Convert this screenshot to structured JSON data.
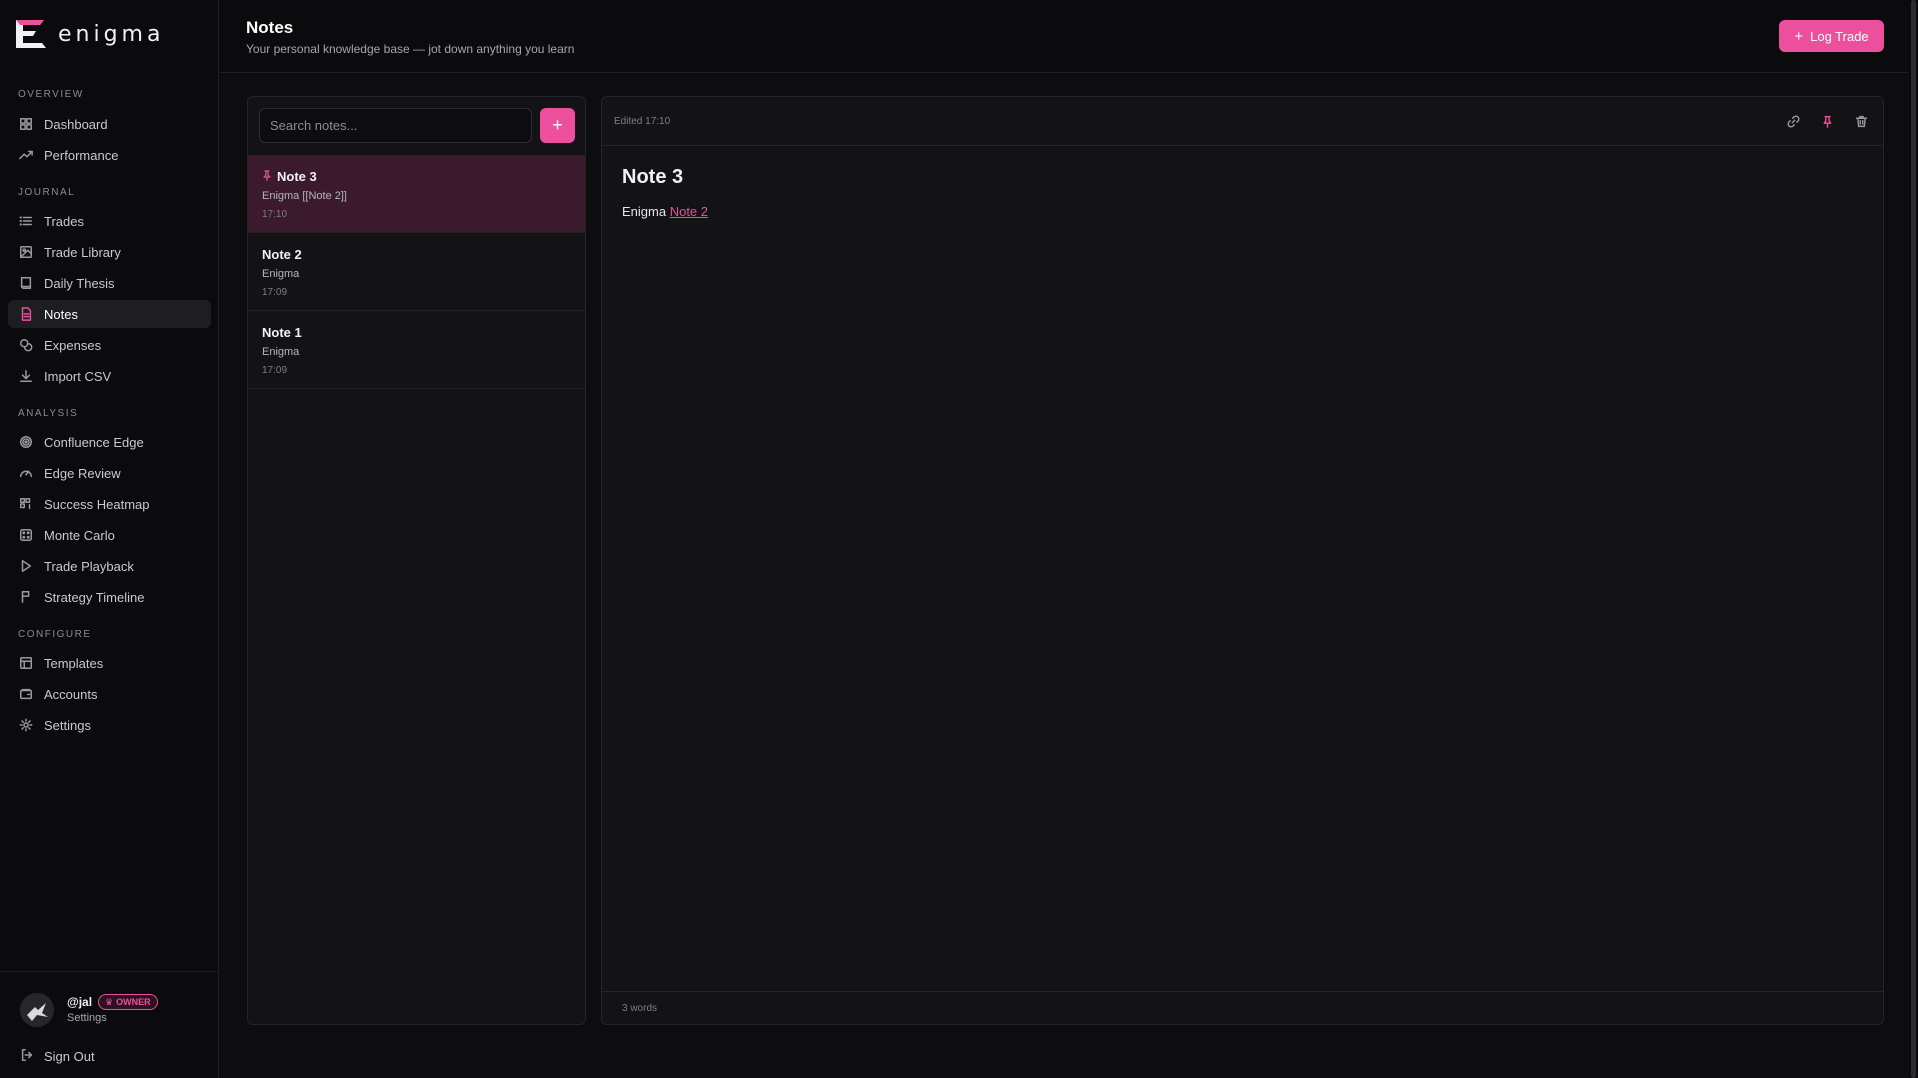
{
  "brand": {
    "name": "enigma",
    "accent": "#ec4f9c"
  },
  "header": {
    "title": "Notes",
    "subtitle": "Your personal knowledge base — jot down anything you learn",
    "log_trade_label": "Log Trade"
  },
  "sidebar": {
    "sections": {
      "overview": "OVERVIEW",
      "journal": "JOURNAL",
      "analysis": "ANALYSIS",
      "configure": "CONFIGURE"
    },
    "items": {
      "dashboard": "Dashboard",
      "performance": "Performance",
      "trades": "Trades",
      "trade_library": "Trade Library",
      "daily_thesis": "Daily Thesis",
      "notes": "Notes",
      "expenses": "Expenses",
      "import_csv": "Import CSV",
      "confluence_edge": "Confluence Edge",
      "edge_review": "Edge Review",
      "success_heatmap": "Success Heatmap",
      "monte_carlo": "Monte Carlo",
      "trade_playback": "Trade Playback",
      "strategy_timeline": "Strategy Timeline",
      "templates": "Templates",
      "accounts": "Accounts",
      "settings": "Settings"
    },
    "user": {
      "handle": "@jal",
      "badge": "OWNER",
      "settings_link": "Settings"
    },
    "sign_out": "Sign Out"
  },
  "notes_list": {
    "search_placeholder": "Search notes...",
    "add_label": "+",
    "notes": [
      {
        "title": "Note 3",
        "preview": "Enigma [[Note 2]]",
        "time": "17:10",
        "pinned": true
      },
      {
        "title": "Note 2",
        "preview": "Enigma",
        "time": "17:09",
        "pinned": false
      },
      {
        "title": "Note 1",
        "preview": "Enigma",
        "time": "17:09",
        "pinned": false
      }
    ]
  },
  "editor": {
    "edited": "Edited 17:10",
    "heading": "Note 3",
    "body_text": "Enigma",
    "body_link": "Note 2",
    "word_count": "3 words"
  }
}
